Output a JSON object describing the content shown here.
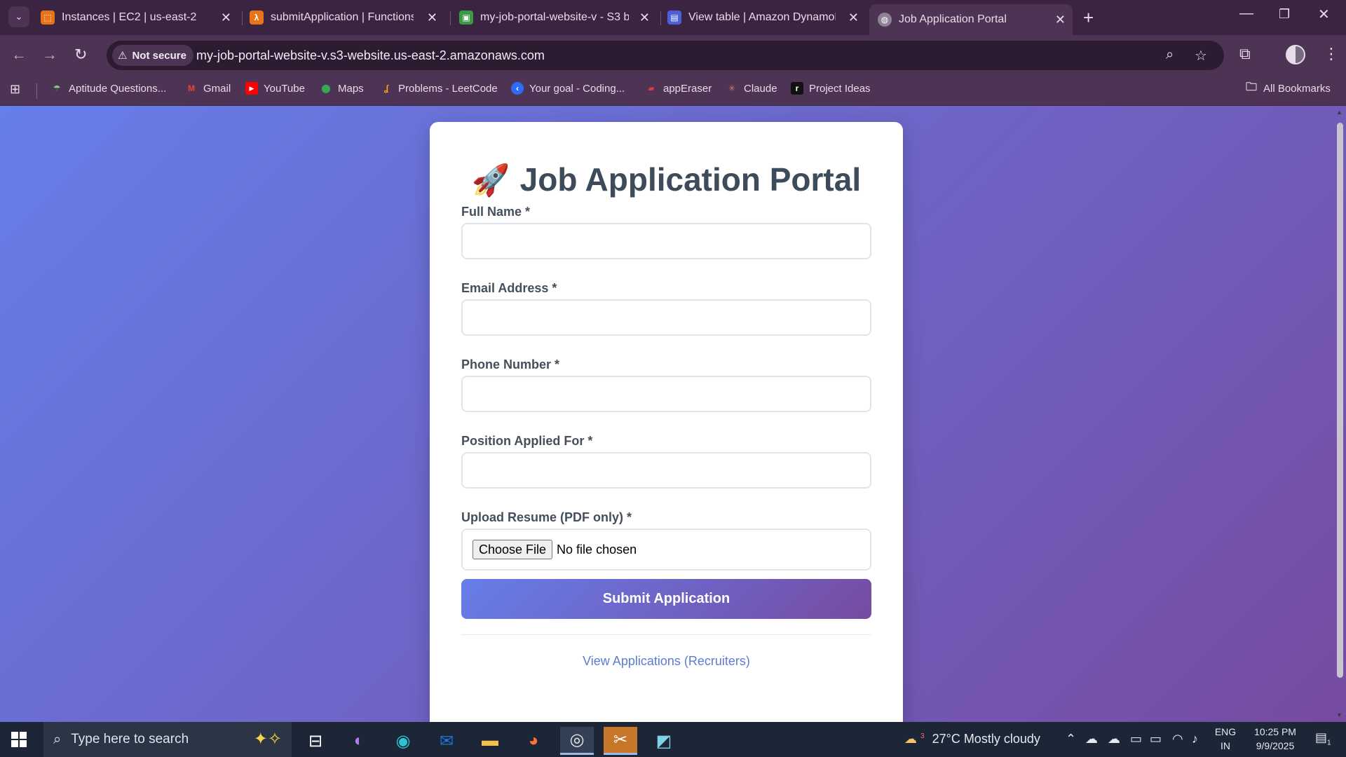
{
  "browser": {
    "tabs": [
      {
        "title": "Instances | EC2 | us-east-2",
        "favicon": "aws-ec2-icon",
        "active": false
      },
      {
        "title": "submitApplication | Functions |",
        "favicon": "aws-lambda-icon",
        "active": false
      },
      {
        "title": "my-job-portal-website-v - S3 b",
        "favicon": "aws-s3-icon",
        "active": false
      },
      {
        "title": "View table | Amazon DynamoD",
        "favicon": "aws-dynamodb-icon",
        "active": false
      },
      {
        "title": "Job Application Portal",
        "favicon": "globe-icon",
        "active": true
      }
    ],
    "security_label": "Not secure",
    "url": "my-job-portal-website-v.s3-website.us-east-2.amazonaws.com",
    "bookmarks": [
      {
        "label": "Aptitude Questions...",
        "icon": "leaf-icon"
      },
      {
        "label": "Gmail",
        "icon": "gmail-icon"
      },
      {
        "label": "YouTube",
        "icon": "youtube-icon"
      },
      {
        "label": "Maps",
        "icon": "maps-icon"
      },
      {
        "label": "Problems - LeetCode",
        "icon": "leetcode-icon"
      },
      {
        "label": "Your goal - Coding...",
        "icon": "coding-icon"
      },
      {
        "label": "appEraser",
        "icon": "apperaser-icon"
      },
      {
        "label": "Claude",
        "icon": "claude-icon"
      },
      {
        "label": "Project Ideas",
        "icon": "project-icon"
      }
    ],
    "all_bookmarks_label": "All Bookmarks"
  },
  "page": {
    "title": "Job Application Portal",
    "title_emoji": "🚀",
    "form": {
      "full_name_label": "Full Name *",
      "email_label": "Email Address *",
      "phone_label": "Phone Number *",
      "position_label": "Position Applied For *",
      "resume_label": "Upload Resume (PDF only) *",
      "choose_file_label": "Choose File",
      "file_status": "No file chosen",
      "submit_label": "Submit Application"
    },
    "recruiter_link": "View Applications (Recruiters)"
  },
  "taskbar": {
    "search_placeholder": "Type here to search",
    "weather": "27°C  Mostly cloudy",
    "weather_badge": "3",
    "language_top": "ENG",
    "language_bottom": "IN",
    "time": "10:25 PM",
    "date": "9/9/2025",
    "notification_count": "1"
  },
  "colors": {
    "page_gradient_start": "#667eea",
    "page_gradient_end": "#764ba2",
    "browser_frame": "#4d3354",
    "link": "#5c7cd1"
  }
}
